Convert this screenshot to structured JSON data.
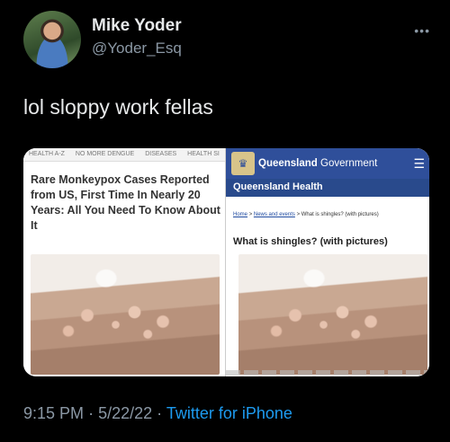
{
  "tweet": {
    "display_name": "Mike Yoder",
    "handle": "@Yoder_Esq",
    "text": "lol sloppy work fellas",
    "time": "9:15 PM",
    "separator": "·",
    "date": "5/22/22",
    "source": "Twitter for iPhone",
    "more_icon": "more-icon"
  },
  "media": {
    "left": {
      "nav": [
        "HEALTH A-Z",
        "NO MORE DENGUE",
        "DISEASES",
        "HEALTH SI"
      ],
      "headline": "Rare Monkeypox Cases Reported from US, First Time In Nearly 20 Years: All You Need To Know About It"
    },
    "right": {
      "brand_bold": "Queensland",
      "brand_rest": " Government",
      "site_title": "Queensland Health",
      "breadcrumb": [
        "Home",
        "News and events",
        "What is shingles? (with pictures)"
      ],
      "page_heading": "What is shingles? (with pictures)"
    }
  },
  "colors": {
    "background": "#000000",
    "link": "#1d9bf0",
    "muted": "#8b98a5",
    "qld_blue": "#2f4f9a"
  }
}
